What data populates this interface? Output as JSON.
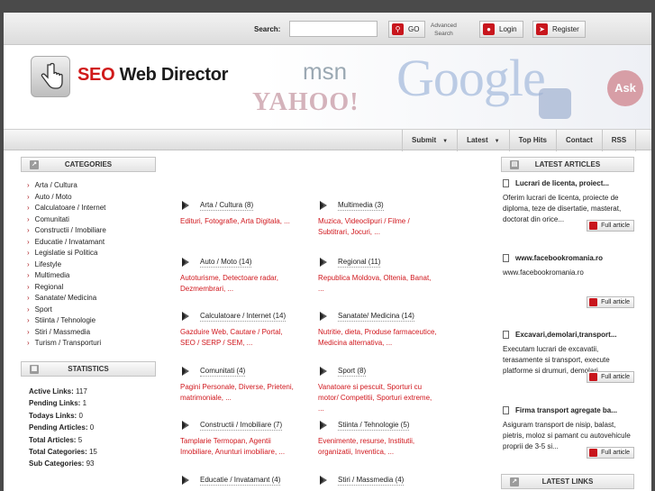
{
  "search": {
    "label": "Search:",
    "placeholder": "",
    "go_label": "GO",
    "advanced_line1": "Advanced",
    "advanced_line2": "Search"
  },
  "account": {
    "login_label": "Login",
    "register_label": "Register"
  },
  "logo": {
    "part1": "SEO",
    "part2": "Web Director"
  },
  "brands": {
    "msn": "msn",
    "yahoo": "YAHOO!",
    "google": "Google",
    "ask": "Ask"
  },
  "nav": [
    {
      "label": "Submit",
      "dropdown": true
    },
    {
      "label": "Latest",
      "dropdown": true
    },
    {
      "label": "Top Hits",
      "dropdown": false
    },
    {
      "label": "Contact",
      "dropdown": false
    },
    {
      "label": "RSS",
      "dropdown": false
    }
  ],
  "categories_box": {
    "title": "CATEGORIES"
  },
  "categories": [
    "Arta / Cultura",
    "Auto / Moto",
    "Calculatoare / Internet",
    "Comunitati",
    "Constructii / Imobiliare",
    "Educatie / Invatamant",
    "Legislatie si Politica",
    "Lifestyle",
    "Multimedia",
    "Regional",
    "Sanatate/ Medicina",
    "Sport",
    "Stiinta / Tehnologie",
    "Stiri / Massmedia",
    "Turism / Transporturi"
  ],
  "statistics_box": {
    "title": "STATISTICS"
  },
  "statistics": [
    {
      "label": "Active Links:",
      "value": "117"
    },
    {
      "label": "Pending Links:",
      "value": "1"
    },
    {
      "label": "Todays Links:",
      "value": "0"
    },
    {
      "label": "Pending Articles:",
      "value": "0"
    },
    {
      "label": "Total Articles:",
      "value": "5"
    },
    {
      "label": "Total Categories:",
      "value": "15"
    },
    {
      "label": "Sub Categories:",
      "value": "93"
    }
  ],
  "grid": [
    {
      "title": "Arta / Cultura (8)",
      "subs": "Edituri, Fotografie, Arta Digitala, ..."
    },
    {
      "title": "Multimedia (3)",
      "subs": "Muzica, Videoclipuri / Filme / Subtitrari, Jocuri, ..."
    },
    {
      "title": "Auto / Moto (14)",
      "subs": "Autoturisme, Detectoare radar, Dezmembrari, ..."
    },
    {
      "title": "Regional (11)",
      "subs": "Republica Moldova, Oltenia, Banat, ..."
    },
    {
      "title": "Calculatoare / Internet (14)",
      "subs": "Gazduire Web, Cautare / Portal, SEO / SERP / SEM, ..."
    },
    {
      "title": "Sanatate/ Medicina (14)",
      "subs": "Nutritie, dieta, Produse farmaceutice, Medicina alternativa, ..."
    },
    {
      "title": "Comunitati (4)",
      "subs": "Pagini Personale, Diverse, Prieteni, matrimoniale, ..."
    },
    {
      "title": "Sport (8)",
      "subs": "Vanatoare si pescuit, Sporturi cu motor/ Competitii, Sporturi extreme, ..."
    },
    {
      "title": "Constructii / Imobiliare (7)",
      "subs": "Tamplarie Termopan, Agentii Imobiliare, Anunturi imobiliare, ..."
    },
    {
      "title": "Stiinta / Tehnologie (5)",
      "subs": "Evenimente, resurse, Institutii, organizatii, Inventica, ..."
    },
    {
      "title": "Educatie / Invatamant (4)",
      "subs": ""
    },
    {
      "title": "Stiri / Massmedia (4)",
      "subs": ""
    }
  ],
  "articles_box": {
    "title": "LATEST ARTICLES"
  },
  "articles": [
    {
      "title": "Lucrari de licenta, proiect...",
      "desc": "Oferim lucrari de licenta, proiecte de diploma, teze de disertatie, masterat, doctorat din orice...",
      "button": "Full article"
    },
    {
      "title": "www.facebookromania.ro",
      "desc": "www.facebookromania.ro",
      "button": "Full article"
    },
    {
      "title": "Excavari,demolari,transport...",
      "desc": "Executam lucrari de excavatii, terasamente si transport, execute platforme si drumuri, demolari,...",
      "button": "Full article"
    },
    {
      "title": "Firma transport agregate ba...",
      "desc": "Asiguram transport de nisip, balast, pietris, moloz si pamant cu autovehicule proprii de 3-5 si...",
      "button": "Full article"
    }
  ],
  "links_box": {
    "title": "LATEST LINKS"
  }
}
